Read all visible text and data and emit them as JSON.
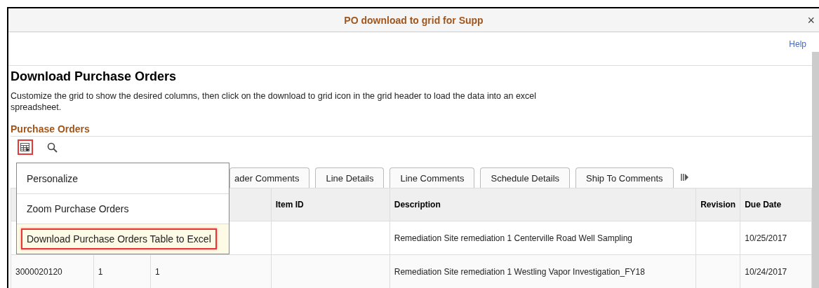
{
  "window": {
    "title": "PO download to grid for Supp",
    "close": "×"
  },
  "help_link": "Help",
  "heading": "Download Purchase Orders",
  "instructions": "Customize the grid to show the desired columns, then click on the download to grid icon in the grid header to load the data into an excel spreadsheet.",
  "grid": {
    "title": "Purchase Orders",
    "tabs": [
      {
        "label": "ader Comments",
        "selected": false
      },
      {
        "label": "Line Details",
        "selected": false
      },
      {
        "label": "Line Comments",
        "selected": false
      },
      {
        "label": "Schedule Details",
        "selected": false
      },
      {
        "label": "Ship To Comments",
        "selected": false
      }
    ],
    "columns": [
      null,
      null,
      null,
      "Item ID",
      "Description",
      "Revision",
      "Due Date"
    ],
    "rows": [
      {
        "cells": [
          null,
          null,
          null,
          null,
          "Remediation Site remediation 1 Centerville Road Well Sampling",
          null,
          "10/25/2017"
        ]
      },
      {
        "cells": [
          "3000020120",
          "1",
          "1",
          null,
          "Remediation Site remediation 1 Westling Vapor Investigation_FY18",
          null,
          "10/24/2017"
        ]
      }
    ],
    "menu": [
      {
        "label": "Personalize",
        "selected": false
      },
      {
        "label": "Zoom Purchase Orders",
        "selected": false
      },
      {
        "label": "Download Purchase Orders Table to Excel",
        "selected": true
      }
    ]
  }
}
